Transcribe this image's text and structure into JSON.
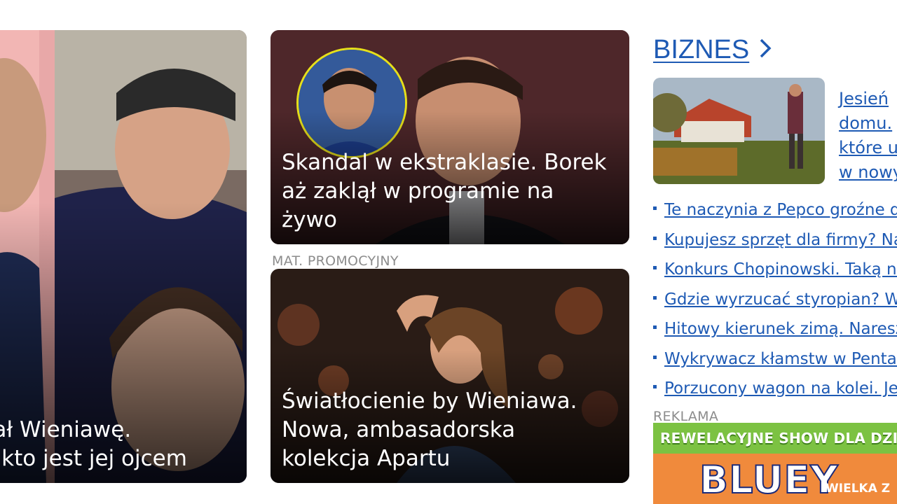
{
  "cards": {
    "left": {
      "title_line1": "ował Wieniawę.",
      "title_line2": "iał, kto jest jej ojcem"
    },
    "middle": {
      "title_line1": "Skandal w ekstraklasie. Borek",
      "title_line2": "aż zaklął w programie na",
      "title_line3": "żywo"
    },
    "promo": {
      "label": "MAT. PROMOCYJNY",
      "title_line1": "Światłocienie by Wieniawa.",
      "title_line2": "Nowa, ambasadorska",
      "title_line3": "kolekcja Apartu"
    }
  },
  "business": {
    "header": "BIZNES",
    "headline_lines": [
      "Jesień",
      "domu.",
      "które u",
      "w nowy"
    ],
    "links": [
      "Te naczynia z Pepco groźne dla",
      "Kupujesz sprzęt dla firmy? Na",
      "Konkurs Chopinowski. Taką na",
      "Gdzie wyrzucać styropian? Wy",
      "Hitowy kierunek zimą. Naresz",
      "Wykrywacz kłamstw w Pentag",
      "Porzucony wagon na kolei. Jes"
    ]
  },
  "ad": {
    "label": "REKLAMA",
    "banner_line": "REWELACYJNE SHOW DLA DZIECI",
    "logo": "BLUEY",
    "sub": "WIELKA Z"
  },
  "colors": {
    "link": "#1e5ab4",
    "label_gray": "#8c8c8c",
    "ad_green": "#7cc242",
    "ad_orange": "#f08a3c"
  },
  "icons": {
    "section_arrow": "chevron-right-icon",
    "story_avatar": "player-portrait-ring"
  }
}
